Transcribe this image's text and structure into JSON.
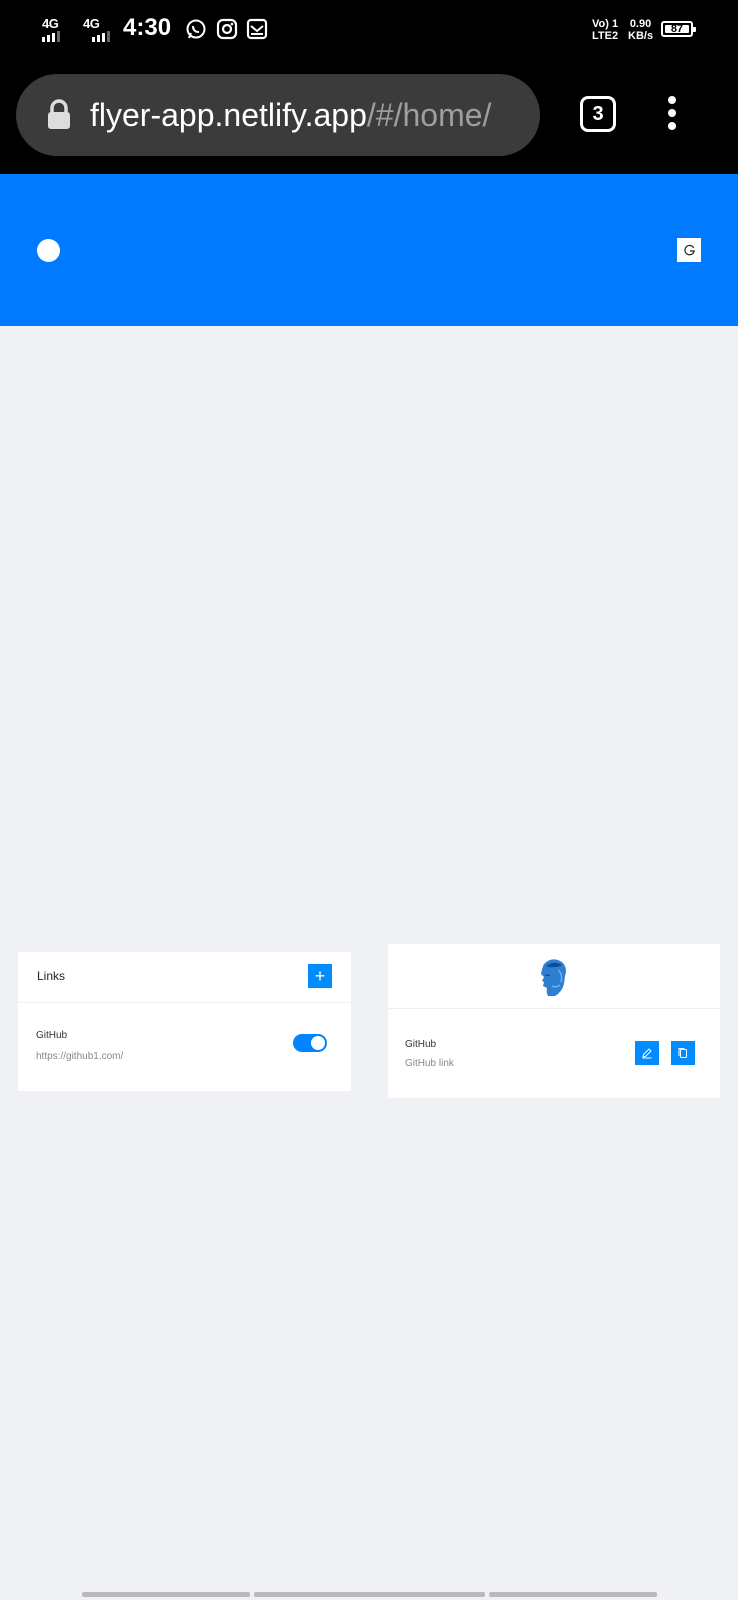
{
  "status_bar": {
    "sim1_network": "4G",
    "sim2_network": "4G",
    "time": "4:30",
    "notification_icons": [
      "whatsapp-icon",
      "instagram-icon",
      "mail-icon"
    ],
    "volte_line1": "Vo) 1",
    "volte_line2": "LTE2",
    "speed_value": "0.90",
    "speed_unit": "KB/s",
    "battery_level": "87"
  },
  "browser": {
    "url_host": "flyer-app.netlify.app",
    "url_path": "/#/home/",
    "tab_count": "3"
  },
  "app": {
    "header_color": "#007bff",
    "accent_color": "#008cff",
    "links_card": {
      "title": "Links",
      "add_button_label": "+",
      "items": [
        {
          "name": "GitHub",
          "url": "https://github1.com/",
          "enabled": true
        }
      ]
    },
    "preview_card": {
      "items": [
        {
          "name": "GitHub",
          "description": "GitHub link"
        }
      ]
    }
  }
}
